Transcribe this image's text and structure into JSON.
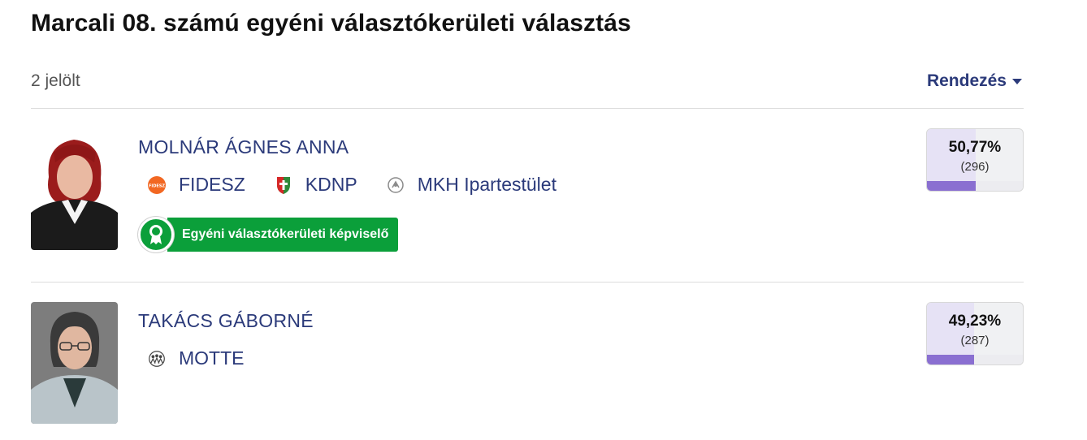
{
  "header": {
    "title": "Marcali 08. számú egyéni választókerületi választás",
    "candidate_count": "2 jelölt",
    "sort_label": "Rendezés"
  },
  "candidates": [
    {
      "name": "MOLNÁR ÁGNES ANNA",
      "photo_icon": "portrait-woman-red-hair",
      "parties": [
        {
          "name": "FIDESZ",
          "icon": "fidesz-logo",
          "logo_text": "FIDESZ",
          "color": "#f26722"
        },
        {
          "name": "KDNP",
          "icon": "kdnp-logo",
          "color": "#2f8a3a"
        },
        {
          "name": "MKH Ipartestület",
          "icon": "mkh-logo",
          "color": "#8a8a8a"
        }
      ],
      "badge": "Egyéni választókerületi képviselő",
      "percent": "50,77%",
      "votes": "(296)",
      "share": 0.5077
    },
    {
      "name": "TAKÁCS GÁBORNÉ",
      "photo_icon": "portrait-woman-glasses",
      "parties": [
        {
          "name": "MOTTE",
          "icon": "motte-logo",
          "color": "#444444"
        }
      ],
      "percent": "49,23%",
      "votes": "(287)",
      "share": 0.4923
    }
  ],
  "colors": {
    "accent": "#2b3a7a",
    "winner_green": "#0b9f3a",
    "bar_purple": "#8a6fd1"
  }
}
